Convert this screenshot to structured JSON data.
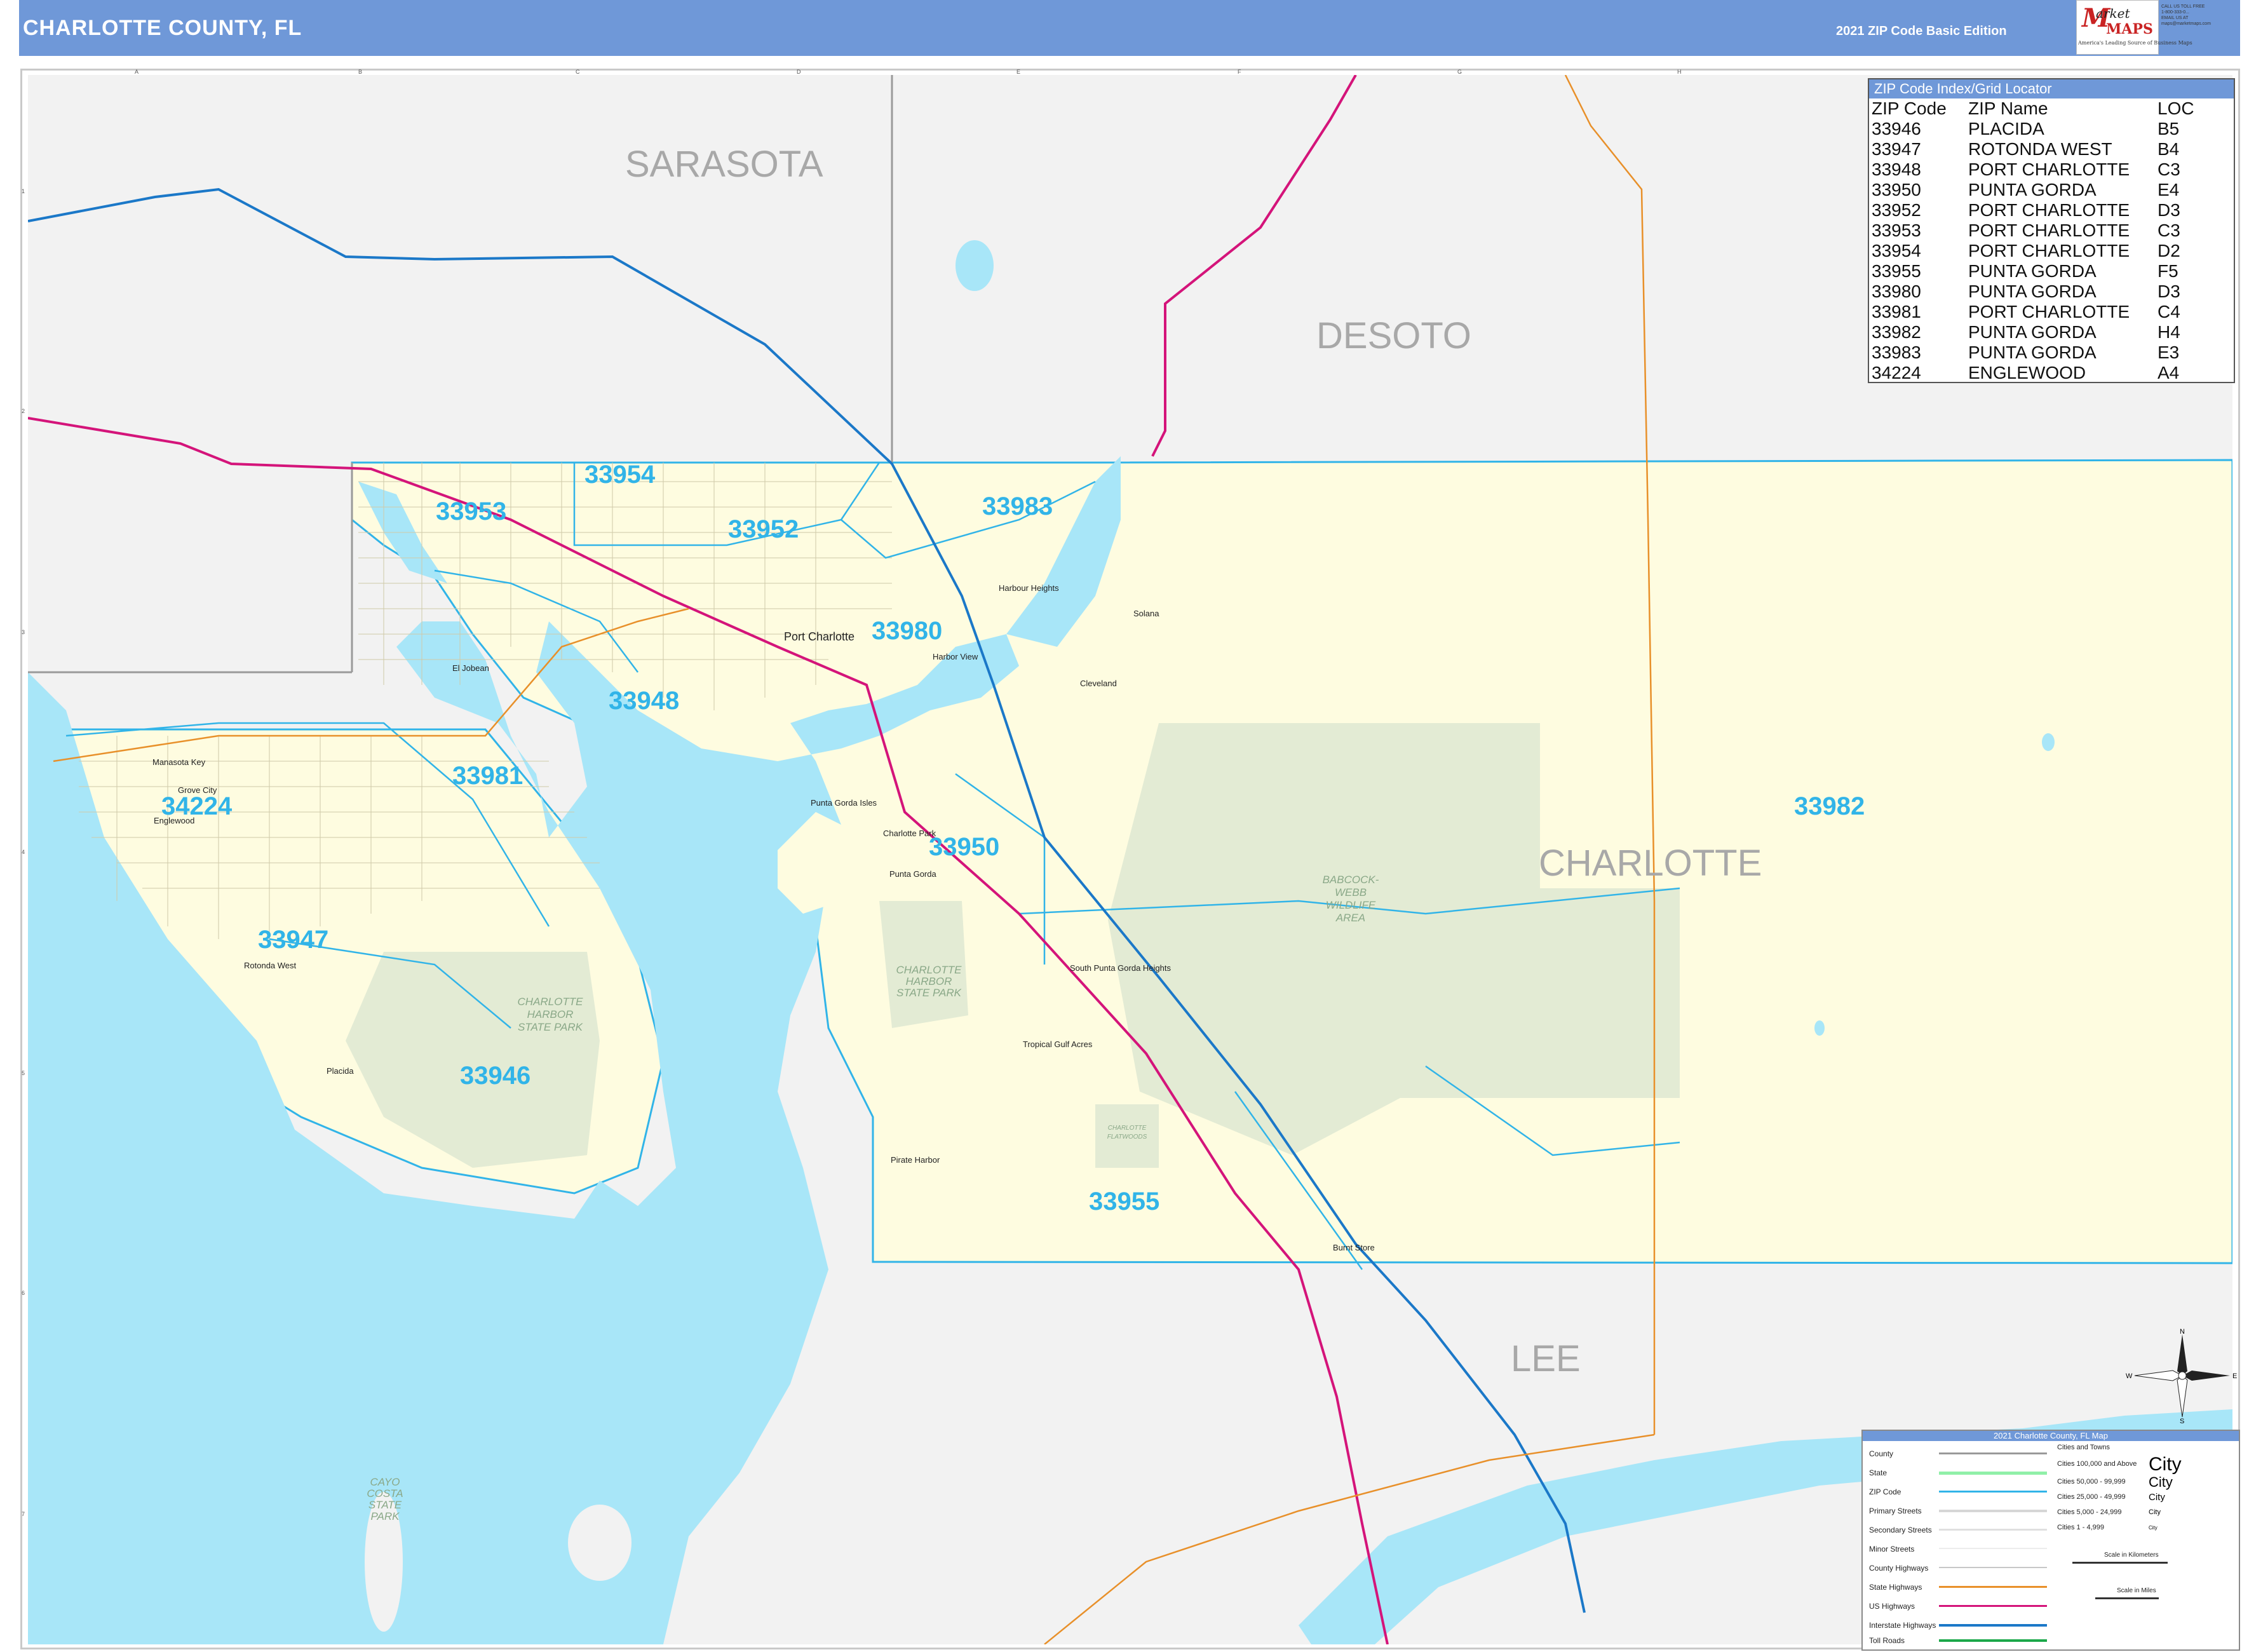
{
  "header": {
    "title": "CHARLOTTE COUNTY, FL",
    "edition": "2021 ZIP Code Basic Edition",
    "logo": {
      "brand_m": "M",
      "brand_line1": "arket",
      "brand_line2": "MAPS",
      "tagline": "America's Leading Source of Business Maps",
      "side_lines": [
        "CALL US TOLL FREE",
        "1-800-333-0...",
        "EMAIL US AT",
        "maps@marketmaps.com"
      ]
    },
    "bar_color": "#6f98d8"
  },
  "grid": {
    "columns": [
      "A",
      "B",
      "C",
      "D",
      "E",
      "F",
      "G",
      "H"
    ],
    "rows": [
      "1",
      "2",
      "3",
      "4",
      "5",
      "6",
      "7"
    ]
  },
  "counties": {
    "sarasota": "SARASOTA",
    "desoto": "DESOTO",
    "charlotte": "CHARLOTTE",
    "lee": "LEE"
  },
  "zip_labels": {
    "z33953": "33953",
    "z33954": "33954",
    "z33952": "33952",
    "z33983": "33983",
    "z33980": "33980",
    "z33948": "33948",
    "z33981": "33981",
    "z34224": "34224",
    "z33950": "33950",
    "z33947": "33947",
    "z33946": "33946",
    "z33955": "33955",
    "z33982": "33982"
  },
  "places": {
    "port_charlotte": "Port Charlotte",
    "punta_gorda": "Punta Gorda",
    "englewood": "Englewood",
    "placida": "Placida",
    "rotonda_west": "Rotonda West",
    "cleveland": "Cleveland",
    "solana": "Solana",
    "charlotte_park": "Charlotte Park",
    "harbour_heights": "Harbour Heights",
    "south_punta_gorda_heights": "South Punta Gorda Heights",
    "tropical_gulf_acres": "Tropical Gulf Acres",
    "punta_gorda_isles": "Punta Gorda Isles",
    "grove_city": "Grove City",
    "manasota_key": "Manasota Key",
    "burnt_store": "Burnt Store",
    "el_jobean": "El Jobean",
    "harbor_view": "Harbor View",
    "pirate_harbor": "Pirate Harbor"
  },
  "parks": {
    "babcock": [
      "BABCOCK-",
      "WEBB",
      "WILDLIFE",
      "AREA"
    ],
    "charlotte_harbor_left": [
      "CHARLOTTE",
      "HARBOR",
      "STATE PARK"
    ],
    "charlotte_harbor_mid": [
      "CHARLOTTE",
      "HARBOR",
      "STATE PARK"
    ],
    "cayo_costa": [
      "CAYO",
      "COSTA",
      "STATE",
      "PARK"
    ],
    "flatwoods": [
      "CHARLOTTE",
      "FLATWOODS"
    ]
  },
  "zip_index": {
    "title": "ZIP Code Index/Grid Locator",
    "headers": [
      "ZIP Code",
      "ZIP Name",
      "LOC"
    ],
    "rows": [
      [
        "33946",
        "PLACIDA",
        "B5"
      ],
      [
        "33947",
        "ROTONDA WEST",
        "B4"
      ],
      [
        "33948",
        "PORT CHARLOTTE",
        "C3"
      ],
      [
        "33950",
        "PUNTA GORDA",
        "E4"
      ],
      [
        "33952",
        "PORT CHARLOTTE",
        "D3"
      ],
      [
        "33953",
        "PORT CHARLOTTE",
        "C3"
      ],
      [
        "33954",
        "PORT CHARLOTTE",
        "D2"
      ],
      [
        "33955",
        "PUNTA GORDA",
        "F5"
      ],
      [
        "33980",
        "PUNTA GORDA",
        "D3"
      ],
      [
        "33981",
        "PORT CHARLOTTE",
        "C4"
      ],
      [
        "33982",
        "PUNTA GORDA",
        "H4"
      ],
      [
        "33983",
        "PUNTA GORDA",
        "E3"
      ],
      [
        "34224",
        "ENGLEWOOD",
        "A4"
      ]
    ]
  },
  "legend": {
    "title": "2021 Charlotte County, FL Map",
    "items": [
      "County",
      "State",
      "ZIP Code",
      "Primary Streets",
      "Secondary Streets",
      "Minor Streets",
      "County Highways",
      "State Highways",
      "US Highways",
      "Interstate Highways",
      "Toll Roads"
    ],
    "cities_heading": "Cities and Towns",
    "cities": [
      [
        "Cities 100,000 and Above",
        "City"
      ],
      [
        "Cities 50,000 - 99,999",
        "City"
      ],
      [
        "Cities 25,000 - 49,999",
        "City"
      ],
      [
        "Cities 5,000 - 24,999",
        "City"
      ],
      [
        "Cities 1 - 4,999",
        "City"
      ]
    ],
    "scale_km": "Scale in Kilometers",
    "scale_mi": "Scale in Miles"
  },
  "compass": {
    "n": "N",
    "s": "S",
    "e": "E",
    "w": "W"
  },
  "colors": {
    "water": "#a8e6f8",
    "county_fill": "#fefce0",
    "outside_fill": "#f2f2f2",
    "park_fill": "#e3ebd4",
    "zip_label": "#31b4e8",
    "us_highway": "#d4147a",
    "interstate": "#1b78c8",
    "state_highway": "#e8902a"
  }
}
